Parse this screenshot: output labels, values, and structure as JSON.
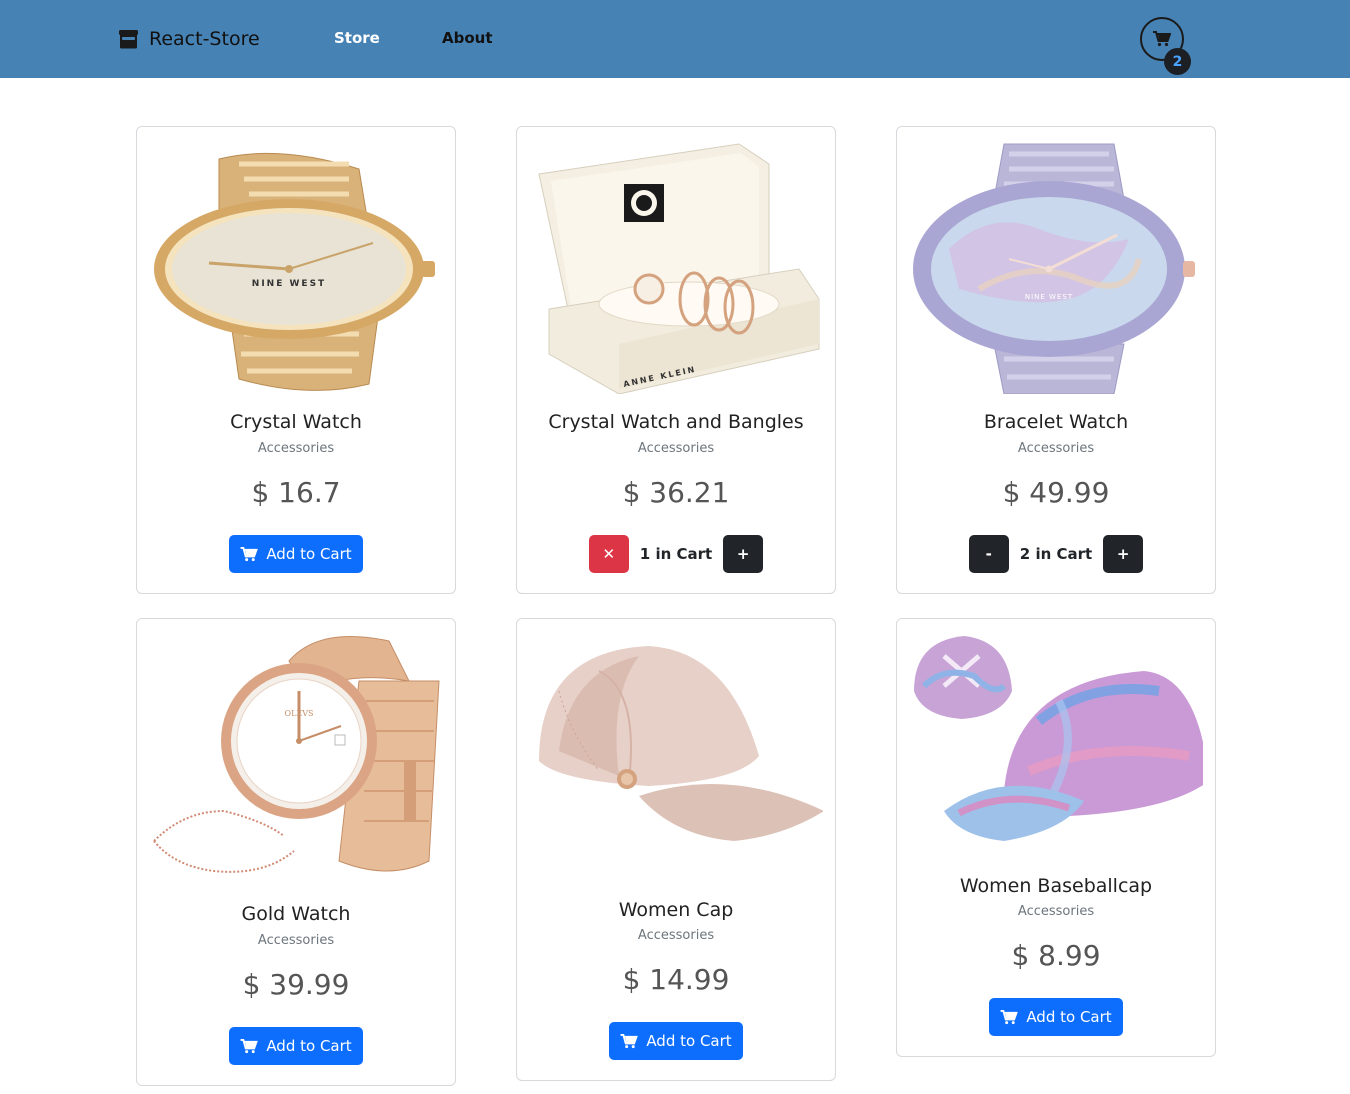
{
  "navbar": {
    "brand": "React-Store",
    "links": [
      "Store",
      "About"
    ],
    "cart_count": "2",
    "color": "#4682b4"
  },
  "products": [
    {
      "title": "Crystal Watch",
      "category": "Accessories",
      "price": "$ 16.7",
      "action": "Add to Cart"
    },
    {
      "title": "Crystal Watch and Bangles",
      "category": "Accessories",
      "price": "$ 36.21",
      "quantity_label": "1 in Cart",
      "remove_symbol": "✕",
      "add_symbol": "+"
    },
    {
      "title": "Bracelet Watch",
      "category": "Accessories",
      "price": "$ 49.99",
      "quantity_label": "2 in Cart",
      "decrement_symbol": "-",
      "add_symbol": "+"
    },
    {
      "title": "Gold Watch",
      "category": "Accessories",
      "price": "$ 39.99",
      "action": "Add to Cart"
    },
    {
      "title": "Women Cap",
      "category": "Accessories",
      "price": "$ 14.99",
      "action": "Add to Cart"
    },
    {
      "title": "Women Baseballcap",
      "category": "Accessories",
      "price": "$ 8.99",
      "action": "Add to Cart"
    }
  ],
  "icons": {
    "brand": "store-icon",
    "cart": "cart-icon"
  },
  "colors": {
    "primary": "#0d6efd",
    "danger": "#dc3545",
    "dark": "#212529"
  }
}
